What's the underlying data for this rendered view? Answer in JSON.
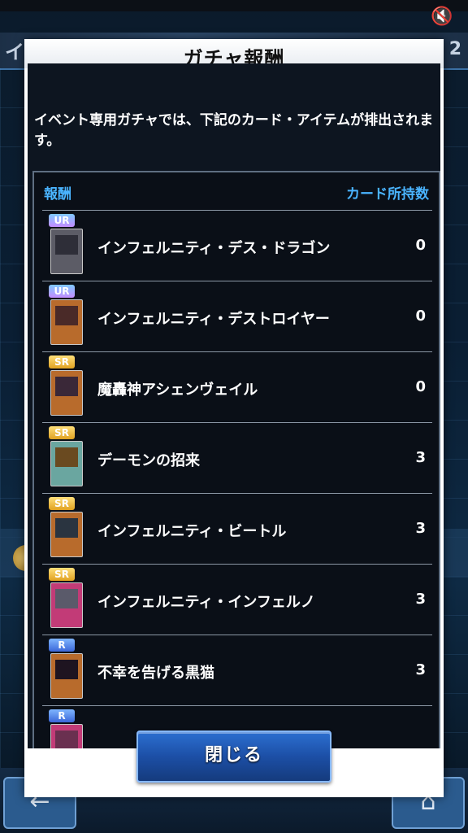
{
  "background": {
    "title_left": "イベ",
    "title_right": "2",
    "back_icon": "left-arrow-icon",
    "home_icon": "home-icon",
    "mute_icon": "mute-icon"
  },
  "modal": {
    "title": "ガチャ報酬",
    "description": "イベント専用ガチャでは、下記のカード・アイテムが排出されます。",
    "column_left": "報酬",
    "column_right": "カード所持数",
    "close_label": "閉じる",
    "rows": [
      {
        "rarity": "UR",
        "name": "インフェルニティ・デス・ドラゴン",
        "count": "0"
      },
      {
        "rarity": "UR",
        "name": "インフェルニティ・デストロイヤー",
        "count": "0"
      },
      {
        "rarity": "SR",
        "name": "魔轟神アシェンヴェイル",
        "count": "0"
      },
      {
        "rarity": "SR",
        "name": "デーモンの招来",
        "count": "3"
      },
      {
        "rarity": "SR",
        "name": "インフェルニティ・ビートル",
        "count": "3"
      },
      {
        "rarity": "SR",
        "name": "インフェルニティ・インフェルノ",
        "count": "3"
      },
      {
        "rarity": "R",
        "name": "不幸を告げる黒猫",
        "count": "3"
      },
      {
        "rarity": "R",
        "name": "",
        "count": ""
      }
    ]
  },
  "colors": {
    "accent_blue": "#4ab4ff",
    "button_blue": "#1c4fa6"
  }
}
